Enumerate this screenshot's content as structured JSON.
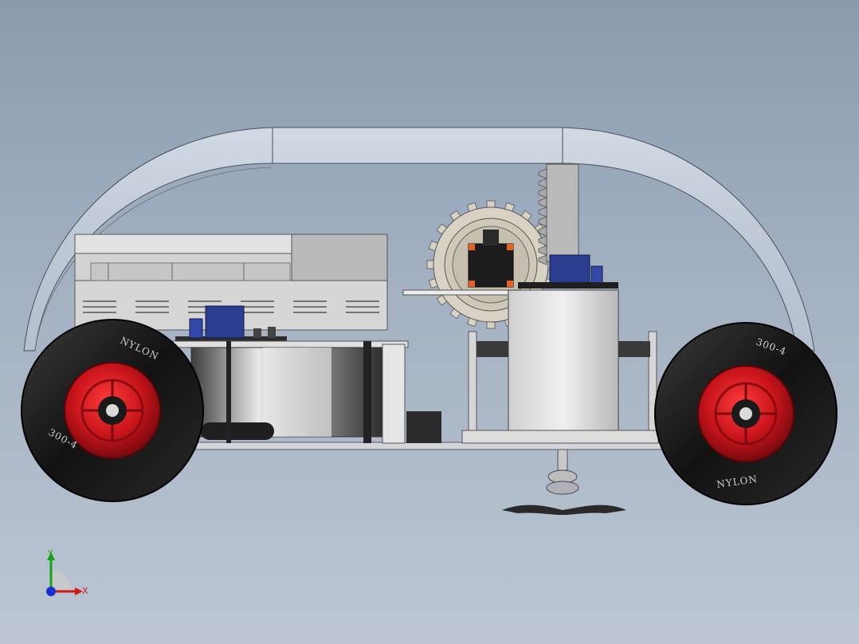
{
  "viewport": {
    "background_top": "#8a9bb0",
    "background_bottom": "#bcc6d3"
  },
  "model": {
    "tyre_markings": {
      "brand": "NYLON",
      "size": "300-4"
    },
    "colors": {
      "rim": "#c8141b",
      "tyre": "#1a1a1a",
      "chassis": "#c9cdd2",
      "motor_driver": "#2b3d8f",
      "dome": "#dfe5ee"
    }
  },
  "triad": {
    "x_label": "X",
    "y_label": "Y",
    "x_color": "#d01818",
    "y_color": "#1aa31a",
    "z_color": "#1a2fd0"
  }
}
